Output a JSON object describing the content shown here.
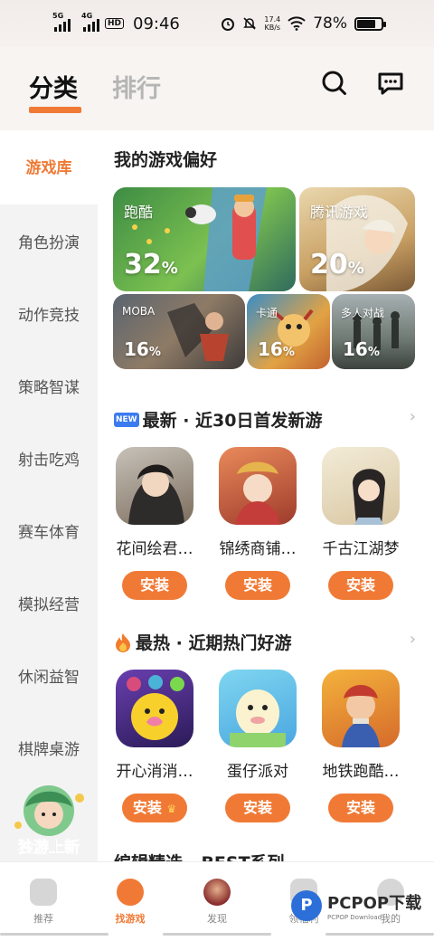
{
  "status": {
    "net1": "5G",
    "net2": "4G",
    "hd": "HD",
    "time": "09:46",
    "speed_value": "17.4",
    "speed_unit": "KB/s",
    "battery": "78%",
    "battery_level": 0.78
  },
  "header": {
    "tab_active": "分类",
    "tab_other": "排行",
    "search_icon": "search-icon",
    "message_icon": "chat-bubble-icon"
  },
  "sidebar": {
    "items": [
      {
        "label": "游戏库",
        "active": true
      },
      {
        "label": "角色扮演",
        "active": false
      },
      {
        "label": "动作竞技",
        "active": false
      },
      {
        "label": "策略智谋",
        "active": false
      },
      {
        "label": "射击吃鸡",
        "active": false
      },
      {
        "label": "赛车体育",
        "active": false
      },
      {
        "label": "模拟经营",
        "active": false
      },
      {
        "label": "休闲益智",
        "active": false
      },
      {
        "label": "棋牌桌游",
        "active": false
      }
    ],
    "mascot_caption": "独游上新"
  },
  "preferences": {
    "title": "我的游戏偏好",
    "items": [
      {
        "label": "跑酷",
        "percent": "32",
        "unit": "%"
      },
      {
        "label": "腾讯游戏",
        "percent": "20",
        "unit": "%"
      },
      {
        "label": "MOBA",
        "percent": "16",
        "unit": "%"
      },
      {
        "label": "卡通",
        "percent": "16",
        "unit": "%"
      },
      {
        "label": "多人对战",
        "percent": "16",
        "unit": "%"
      }
    ]
  },
  "newest": {
    "badge": "NEW",
    "title": "最新 · 近30日首发新游",
    "arrow": "›",
    "games": [
      {
        "name": "花间绘君…",
        "button": "安装"
      },
      {
        "name": "锦绣商铺…",
        "button": "安装"
      },
      {
        "name": "千古江湖梦",
        "button": "安装"
      }
    ]
  },
  "hottest": {
    "title": "最热 · 近期热门好游",
    "arrow": "›",
    "games": [
      {
        "name": "开心消消…",
        "button": "安装"
      },
      {
        "name": "蛋仔派对",
        "button": "安装"
      },
      {
        "name": "地铁跑酷…",
        "button": "安装"
      }
    ]
  },
  "editor": {
    "title": "编辑精选 · BEST系列"
  },
  "bottom_nav": {
    "items": [
      {
        "label": "推荐"
      },
      {
        "label": "找游戏"
      },
      {
        "label": "发现"
      },
      {
        "label": "领福利"
      },
      {
        "label": "我的"
      }
    ]
  },
  "watermark": {
    "brand": "PCPOP下载",
    "sub": "PCPOP Download"
  },
  "colors": {
    "accent": "#f07a35",
    "sidebar_bg": "#f3f3f3"
  }
}
